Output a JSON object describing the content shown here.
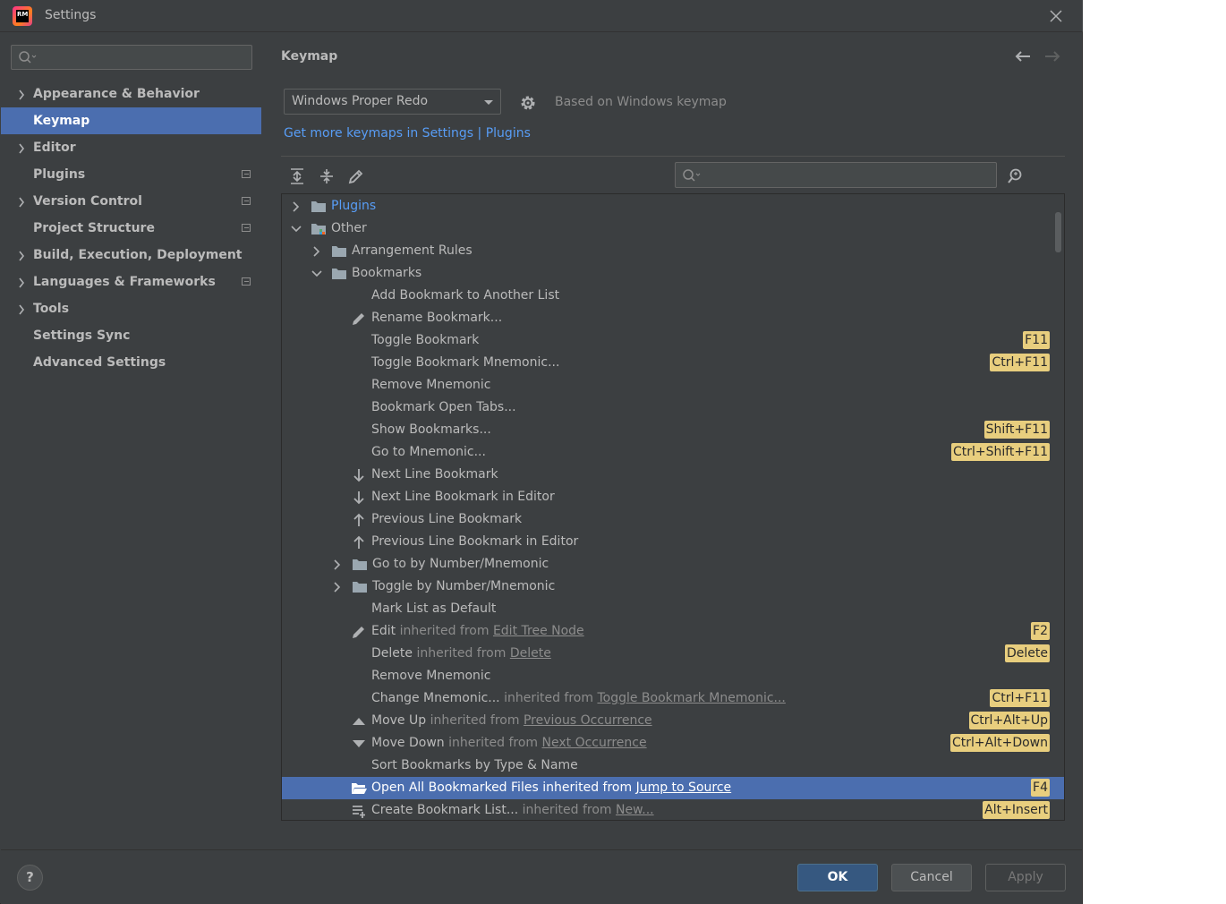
{
  "window": {
    "title": "Settings",
    "logo_text": "RM"
  },
  "sidebar": {
    "search_placeholder": "",
    "items": [
      {
        "label": "Appearance & Behavior",
        "expandable": true,
        "badge": false,
        "selected": false
      },
      {
        "label": "Keymap",
        "expandable": false,
        "badge": false,
        "selected": true
      },
      {
        "label": "Editor",
        "expandable": true,
        "badge": false,
        "selected": false
      },
      {
        "label": "Plugins",
        "expandable": false,
        "badge": true,
        "selected": false
      },
      {
        "label": "Version Control",
        "expandable": true,
        "badge": true,
        "selected": false
      },
      {
        "label": "Project Structure",
        "expandable": false,
        "badge": true,
        "selected": false
      },
      {
        "label": "Build, Execution, Deployment",
        "expandable": true,
        "badge": false,
        "selected": false
      },
      {
        "label": "Languages & Frameworks",
        "expandable": true,
        "badge": true,
        "selected": false
      },
      {
        "label": "Tools",
        "expandable": true,
        "badge": false,
        "selected": false
      },
      {
        "label": "Settings Sync",
        "expandable": false,
        "badge": false,
        "selected": false
      },
      {
        "label": "Advanced Settings",
        "expandable": false,
        "badge": false,
        "selected": false
      }
    ]
  },
  "main": {
    "title": "Keymap",
    "keymap_value": "Windows Proper Redo",
    "based_on": "Based on Windows keymap",
    "more_link": "Get more keymaps in Settings | Plugins",
    "tree_search_placeholder": ""
  },
  "tree": {
    "rows": [
      {
        "indent": 0,
        "chev": "right",
        "icon": "folder-icon",
        "text": "Plugins",
        "link_color": true
      },
      {
        "indent": 0,
        "chev": "down",
        "icon": "folder-special-icon",
        "text": "Other"
      },
      {
        "indent": 1,
        "chev": "right",
        "icon": "folder-icon",
        "text": "Arrangement Rules"
      },
      {
        "indent": 1,
        "chev": "down",
        "icon": "folder-icon",
        "text": "Bookmarks"
      },
      {
        "indent": 2,
        "text": "Add Bookmark to Another List"
      },
      {
        "indent": 2,
        "icon": "pencil-icon",
        "text": "Rename Bookmark..."
      },
      {
        "indent": 2,
        "text": "Toggle Bookmark",
        "shortcut": "F11"
      },
      {
        "indent": 2,
        "text": "Toggle Bookmark Mnemonic...",
        "shortcut": "Ctrl+F11"
      },
      {
        "indent": 2,
        "text": "Remove Mnemonic"
      },
      {
        "indent": 2,
        "text": "Bookmark Open Tabs..."
      },
      {
        "indent": 2,
        "text": "Show Bookmarks...",
        "shortcut": "Shift+F11"
      },
      {
        "indent": 2,
        "text": "Go to Mnemonic...",
        "shortcut": "Ctrl+Shift+F11"
      },
      {
        "indent": 2,
        "icon": "arrow-down-icon",
        "text": "Next Line Bookmark"
      },
      {
        "indent": 2,
        "icon": "arrow-down-icon",
        "text": "Next Line Bookmark in Editor"
      },
      {
        "indent": 2,
        "icon": "arrow-up-icon",
        "text": "Previous Line Bookmark"
      },
      {
        "indent": 2,
        "icon": "arrow-up-icon",
        "text": "Previous Line Bookmark in Editor"
      },
      {
        "indent": 2,
        "chev": "right",
        "icon": "folder-icon",
        "text": "Go to by Number/Mnemonic"
      },
      {
        "indent": 2,
        "chev": "right",
        "icon": "folder-icon",
        "text": "Toggle by Number/Mnemonic"
      },
      {
        "indent": 2,
        "text": "Mark List as Default"
      },
      {
        "indent": 2,
        "icon": "pencil-icon",
        "text": "Edit",
        "inherit": "inherited from",
        "link": "Edit Tree Node",
        "shortcut": "F2"
      },
      {
        "indent": 2,
        "text": "Delete",
        "inherit": "inherited from",
        "link": "Delete",
        "shortcut": "Delete"
      },
      {
        "indent": 2,
        "text": "Remove Mnemonic"
      },
      {
        "indent": 2,
        "text": "Change Mnemonic...",
        "inherit": "inherited from",
        "link": "Toggle Bookmark Mnemonic...",
        "shortcut": "Ctrl+F11"
      },
      {
        "indent": 2,
        "icon": "triangle-up-icon",
        "text": "Move Up",
        "inherit": "inherited from",
        "link": "Previous Occurrence",
        "shortcut": "Ctrl+Alt+Up"
      },
      {
        "indent": 2,
        "icon": "triangle-down-icon",
        "text": "Move Down",
        "inherit": "inherited from",
        "link": "Next Occurrence",
        "shortcut": "Ctrl+Alt+Down"
      },
      {
        "indent": 2,
        "text": "Sort Bookmarks by Type & Name"
      },
      {
        "indent": 2,
        "icon": "folder-open-icon",
        "text": "Open All Bookmarked Files",
        "inherit": "inherited from",
        "link": "Jump to Source",
        "shortcut": "F4",
        "selected": true
      },
      {
        "indent": 2,
        "icon": "add-list-icon",
        "text": "Create Bookmark List...",
        "inherit": "inherited from",
        "link": "New...",
        "shortcut": "Alt+Insert"
      }
    ]
  },
  "footer": {
    "help": "?",
    "ok": "OK",
    "cancel": "Cancel",
    "apply": "Apply"
  },
  "colors": {
    "background": "#3c3f41",
    "selection": "#4b6eaf",
    "link": "#589df6",
    "shortcut_bg": "#e8ce7e"
  }
}
